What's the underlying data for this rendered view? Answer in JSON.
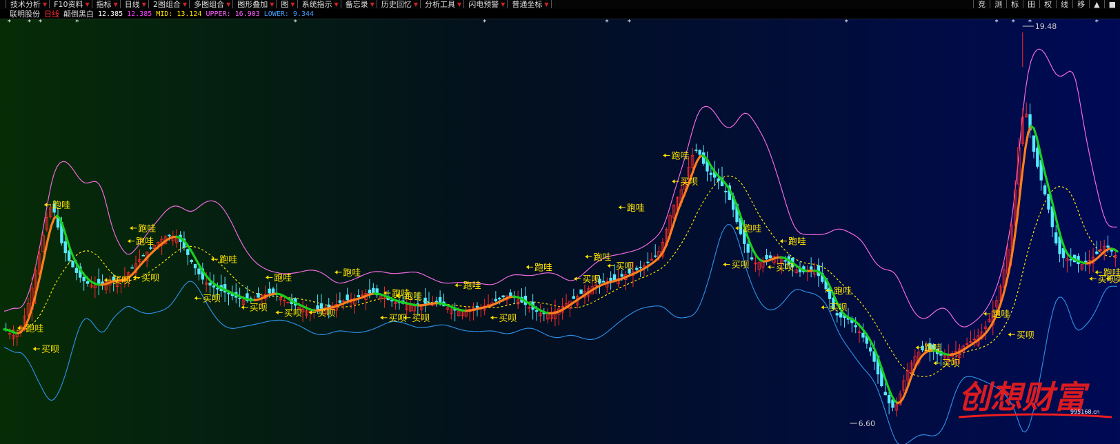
{
  "toolbar": {
    "items": [
      "技术分析",
      "F10资料",
      "指标",
      "日线",
      "2图组合",
      "多图组合",
      "图形叠加",
      "图",
      "系统指示",
      "备忘录",
      "历史回忆",
      "分析工具",
      "闪电预警",
      "普通坐标"
    ],
    "right_items": [
      "竞",
      "测",
      "标",
      "田",
      "权",
      "线",
      "移",
      "▲",
      "■"
    ]
  },
  "legend": {
    "stock_name": "联明股份",
    "period": "日线",
    "mode": "颠倒黑白",
    "v1": "12.385",
    "v2": "12.385",
    "mid": "MID: 13.124",
    "upper": "UPPER: 16.903",
    "lower": "LOWER: 9.344"
  },
  "colors": {
    "background_start": "#062c06",
    "background_end": "#000a55",
    "bull_candle": "#ff2a2a",
    "bear_candle": "#55e8ff",
    "orange_line": "#ff7f1e",
    "green_line": "#18d020",
    "upper_band": "#f06ae0",
    "lower_band": "#2b8ce0",
    "mid_band": "#ffe600",
    "signal": "#ffe600",
    "watermark": "#ee1d1d"
  },
  "chart_data": {
    "type": "candlestick",
    "high_label": "19.48",
    "low_label": "6.60",
    "price_range": [
      6.6,
      19.48
    ],
    "signal_labels": {
      "sell": "跑哇",
      "buy": "买呗"
    },
    "series": [
      {
        "name": "MID",
        "last": 13.124
      },
      {
        "name": "UPPER",
        "last": 16.903
      },
      {
        "name": "LOWER",
        "last": 9.344
      }
    ],
    "close_path": [
      9.9,
      9.7,
      10.8,
      12.8,
      14.6,
      13.1,
      12.2,
      11.7,
      11.6,
      11.8,
      11.8,
      12.3,
      12.8,
      13.2,
      13.5,
      13.3,
      12.5,
      11.8,
      11.5,
      11.3,
      11.1,
      11.0,
      11.2,
      11.3,
      11.0,
      10.8,
      10.6,
      10.7,
      10.8,
      11.0,
      11.1,
      11.3,
      11.2,
      11.0,
      10.9,
      10.8,
      10.9,
      10.9,
      10.7,
      10.6,
      10.7,
      10.8,
      11.0,
      11.2,
      11.0,
      10.7,
      10.5,
      10.6,
      10.9,
      11.2,
      11.5,
      11.7,
      11.8,
      12.0,
      12.2,
      12.5,
      13.0,
      14.5,
      15.5,
      16.8,
      16.0,
      15.6,
      14.8,
      13.4,
      12.5,
      12.6,
      12.7,
      12.4,
      12.1,
      12.2,
      11.6,
      10.5,
      10.3,
      9.8,
      9.0,
      7.6,
      6.9,
      8.2,
      9.0,
      9.1,
      8.9,
      9.0,
      9.3,
      9.6,
      10.2,
      11.5,
      14.0,
      18.2,
      16.5,
      14.8,
      12.9,
      12.6,
      12.4,
      12.7,
      13.1,
      12.7
    ],
    "sell_signals": [
      {
        "pos": 0.012,
        "price": 9.95
      },
      {
        "pos": 0.036,
        "price": 14.7
      },
      {
        "pos": 0.111,
        "price": 13.3
      },
      {
        "pos": 0.113,
        "price": 13.8
      },
      {
        "pos": 0.186,
        "price": 12.6
      },
      {
        "pos": 0.235,
        "price": 11.9
      },
      {
        "pos": 0.297,
        "price": 12.1
      },
      {
        "pos": 0.341,
        "price": 11.3
      },
      {
        "pos": 0.352,
        "price": 11.2
      },
      {
        "pos": 0.405,
        "price": 11.6
      },
      {
        "pos": 0.469,
        "price": 12.3
      },
      {
        "pos": 0.522,
        "price": 12.7
      },
      {
        "pos": 0.552,
        "price": 14.6
      },
      {
        "pos": 0.592,
        "price": 16.6
      },
      {
        "pos": 0.657,
        "price": 13.8
      },
      {
        "pos": 0.697,
        "price": 13.3
      },
      {
        "pos": 0.738,
        "price": 11.4
      },
      {
        "pos": 0.819,
        "price": 9.2
      },
      {
        "pos": 0.88,
        "price": 10.5
      },
      {
        "pos": 0.98,
        "price": 12.1
      }
    ],
    "buy_signals": [
      {
        "pos": 0.026,
        "price": 9.15
      },
      {
        "pos": 0.09,
        "price": 11.8
      },
      {
        "pos": 0.116,
        "price": 11.9
      },
      {
        "pos": 0.171,
        "price": 11.1
      },
      {
        "pos": 0.213,
        "price": 10.75
      },
      {
        "pos": 0.244,
        "price": 10.55
      },
      {
        "pos": 0.274,
        "price": 10.55
      },
      {
        "pos": 0.338,
        "price": 10.35
      },
      {
        "pos": 0.359,
        "price": 10.35
      },
      {
        "pos": 0.437,
        "price": 10.35
      },
      {
        "pos": 0.512,
        "price": 11.85
      },
      {
        "pos": 0.542,
        "price": 12.35
      },
      {
        "pos": 0.6,
        "price": 15.6
      },
      {
        "pos": 0.646,
        "price": 12.4
      },
      {
        "pos": 0.686,
        "price": 12.3
      },
      {
        "pos": 0.734,
        "price": 10.75
      },
      {
        "pos": 0.835,
        "price": 8.6
      },
      {
        "pos": 0.902,
        "price": 9.7
      },
      {
        "pos": 0.975,
        "price": 11.85
      },
      {
        "pos": 0.99,
        "price": 11.85
      }
    ]
  },
  "watermark": {
    "text": "创想财富",
    "site": "995168.cn"
  }
}
